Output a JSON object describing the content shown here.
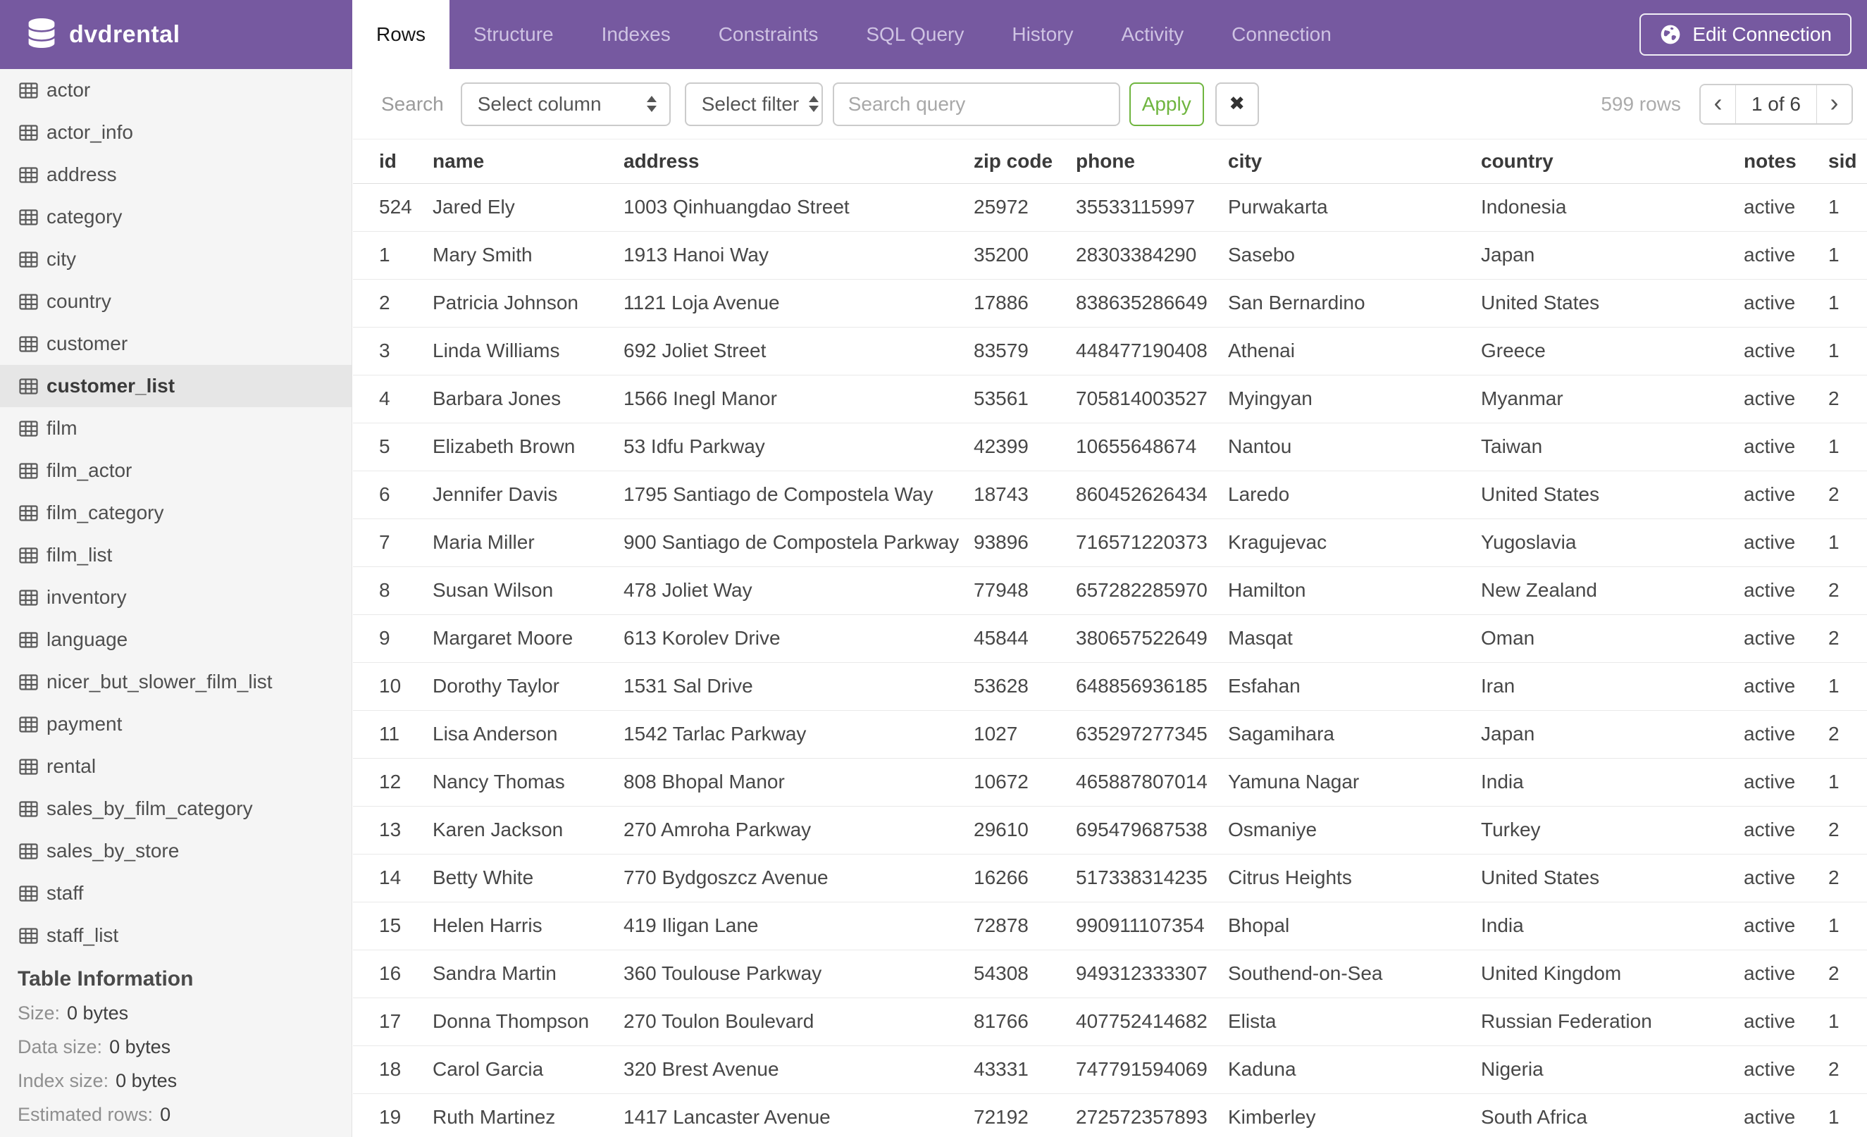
{
  "header": {
    "title": "dvdrental",
    "tabs": [
      {
        "label": "Rows",
        "active": true
      },
      {
        "label": "Structure",
        "active": false
      },
      {
        "label": "Indexes",
        "active": false
      },
      {
        "label": "Constraints",
        "active": false
      },
      {
        "label": "SQL Query",
        "active": false
      },
      {
        "label": "History",
        "active": false
      },
      {
        "label": "Activity",
        "active": false
      },
      {
        "label": "Connection",
        "active": false
      }
    ],
    "edit_connection_label": "Edit Connection"
  },
  "sidebar": {
    "tables": [
      "actor",
      "actor_info",
      "address",
      "category",
      "city",
      "country",
      "customer",
      "customer_list",
      "film",
      "film_actor",
      "film_category",
      "film_list",
      "inventory",
      "language",
      "nicer_but_slower_film_list",
      "payment",
      "rental",
      "sales_by_film_category",
      "sales_by_store",
      "staff",
      "staff_list"
    ],
    "selected_table": "customer_list",
    "info": {
      "heading": "Table Information",
      "items": [
        {
          "label": "Size:",
          "value": "0 bytes"
        },
        {
          "label": "Data size:",
          "value": "0 bytes"
        },
        {
          "label": "Index size:",
          "value": "0 bytes"
        },
        {
          "label": "Estimated rows:",
          "value": "0"
        }
      ]
    }
  },
  "toolbar": {
    "search_label": "Search",
    "column_select_value": "Select column",
    "filter_select_value": "Select filter",
    "query_placeholder": "Search query",
    "query_value": "",
    "apply_label": "Apply",
    "clear_label": "✖",
    "rows_count": "599 rows",
    "pagination": {
      "prev": "‹",
      "current": "1 of 6",
      "next": "›"
    }
  },
  "table": {
    "columns": [
      "id",
      "name",
      "address",
      "zip code",
      "phone",
      "city",
      "country",
      "notes",
      "sid"
    ],
    "rows": [
      [
        "524",
        "Jared Ely",
        "1003 Qinhuangdao Street",
        "25972",
        "35533115997",
        "Purwakarta",
        "Indonesia",
        "active",
        "1"
      ],
      [
        "1",
        "Mary Smith",
        "1913 Hanoi Way",
        "35200",
        "28303384290",
        "Sasebo",
        "Japan",
        "active",
        "1"
      ],
      [
        "2",
        "Patricia Johnson",
        "1121 Loja Avenue",
        "17886",
        "838635286649",
        "San Bernardino",
        "United States",
        "active",
        "1"
      ],
      [
        "3",
        "Linda Williams",
        "692 Joliet Street",
        "83579",
        "448477190408",
        "Athenai",
        "Greece",
        "active",
        "1"
      ],
      [
        "4",
        "Barbara Jones",
        "1566 Inegl Manor",
        "53561",
        "705814003527",
        "Myingyan",
        "Myanmar",
        "active",
        "2"
      ],
      [
        "5",
        "Elizabeth Brown",
        "53 Idfu Parkway",
        "42399",
        "10655648674",
        "Nantou",
        "Taiwan",
        "active",
        "1"
      ],
      [
        "6",
        "Jennifer Davis",
        "1795 Santiago de Compostela Way",
        "18743",
        "860452626434",
        "Laredo",
        "United States",
        "active",
        "2"
      ],
      [
        "7",
        "Maria Miller",
        "900 Santiago de Compostela Parkway",
        "93896",
        "716571220373",
        "Kragujevac",
        "Yugoslavia",
        "active",
        "1"
      ],
      [
        "8",
        "Susan Wilson",
        "478 Joliet Way",
        "77948",
        "657282285970",
        "Hamilton",
        "New Zealand",
        "active",
        "2"
      ],
      [
        "9",
        "Margaret Moore",
        "613 Korolev Drive",
        "45844",
        "380657522649",
        "Masqat",
        "Oman",
        "active",
        "2"
      ],
      [
        "10",
        "Dorothy Taylor",
        "1531 Sal Drive",
        "53628",
        "648856936185",
        "Esfahan",
        "Iran",
        "active",
        "1"
      ],
      [
        "11",
        "Lisa Anderson",
        "1542 Tarlac Parkway",
        "1027",
        "635297277345",
        "Sagamihara",
        "Japan",
        "active",
        "2"
      ],
      [
        "12",
        "Nancy Thomas",
        "808 Bhopal Manor",
        "10672",
        "465887807014",
        "Yamuna Nagar",
        "India",
        "active",
        "1"
      ],
      [
        "13",
        "Karen Jackson",
        "270 Amroha Parkway",
        "29610",
        "695479687538",
        "Osmaniye",
        "Turkey",
        "active",
        "2"
      ],
      [
        "14",
        "Betty White",
        "770 Bydgoszcz Avenue",
        "16266",
        "517338314235",
        "Citrus Heights",
        "United States",
        "active",
        "2"
      ],
      [
        "15",
        "Helen Harris",
        "419 Iligan Lane",
        "72878",
        "990911107354",
        "Bhopal",
        "India",
        "active",
        "1"
      ],
      [
        "16",
        "Sandra Martin",
        "360 Toulouse Parkway",
        "54308",
        "949312333307",
        "Southend-on-Sea",
        "United Kingdom",
        "active",
        "2"
      ],
      [
        "17",
        "Donna Thompson",
        "270 Toulon Boulevard",
        "81766",
        "407752414682",
        "Elista",
        "Russian Federation",
        "active",
        "1"
      ],
      [
        "18",
        "Carol Garcia",
        "320 Brest Avenue",
        "43331",
        "747791594069",
        "Kaduna",
        "Nigeria",
        "active",
        "2"
      ],
      [
        "19",
        "Ruth Martinez",
        "1417 Lancaster Avenue",
        "72192",
        "272572357893",
        "Kimberley",
        "South Africa",
        "active",
        "1"
      ]
    ]
  },
  "colors": {
    "header_purple": "#7659A0",
    "tab_inactive_text": "#CFC3E3",
    "apply_green": "#6FB53F",
    "sidebar_bg": "#F5F5F5",
    "selected_item_bg": "#E6E6E6"
  }
}
